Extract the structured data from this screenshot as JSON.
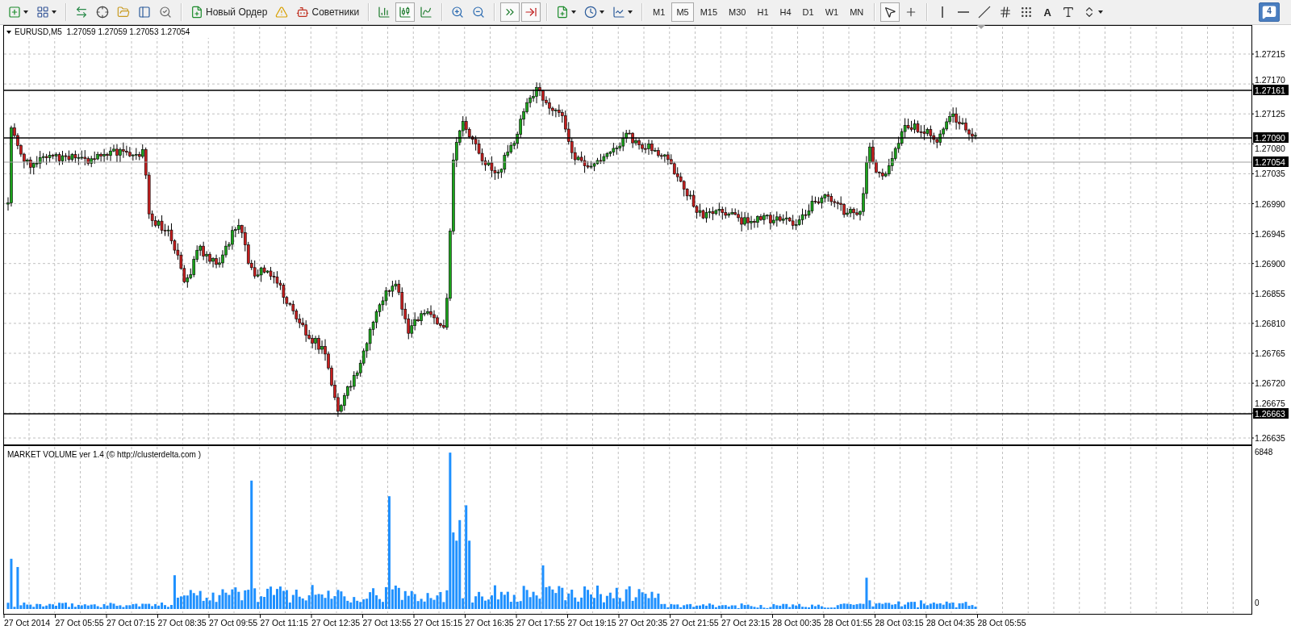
{
  "toolbar": {
    "buttons": [
      {
        "kind": "new-order",
        "label": "Новый Ордер"
      },
      {
        "kind": "experts",
        "label": "Советники"
      }
    ],
    "timeframes": [
      {
        "label": "M1",
        "selected": false
      },
      {
        "label": "M5",
        "selected": true
      },
      {
        "label": "M15",
        "selected": false
      },
      {
        "label": "M30",
        "selected": false
      },
      {
        "label": "H1",
        "selected": false
      },
      {
        "label": "H4",
        "selected": false
      },
      {
        "label": "D1",
        "selected": false
      },
      {
        "label": "W1",
        "selected": false
      },
      {
        "label": "MN",
        "selected": false
      }
    ],
    "text_tool": "A",
    "notification_count": "4"
  },
  "chart": {
    "title": "EURUSD,M5  1.27059 1.27059 1.27053 1.27054",
    "price_labels": [
      "1.27215",
      "1.27170",
      "1.27125",
      "1.27080",
      "1.27035",
      "1.26990",
      "1.26945",
      "1.26900",
      "1.26855",
      "1.26810",
      "1.26765",
      "1.26720",
      "1.26675",
      "1.26635"
    ],
    "levels": [
      {
        "kind": "line",
        "label": "1.27161"
      },
      {
        "kind": "line",
        "label": "1.27090"
      },
      {
        "kind": "current",
        "label": "1.27054"
      },
      {
        "kind": "line",
        "label": "1.26663"
      }
    ]
  },
  "volume": {
    "title": "MARKET VOLUME ver 1.4 (© http://clusterdelta.com )",
    "scale_max": "6848",
    "scale_min": "0"
  },
  "time_labels": [
    "27 Oct 2014",
    "27 Oct 05:55",
    "27 Oct 07:15",
    "27 Oct 08:35",
    "27 Oct 09:55",
    "27 Oct 11:15",
    "27 Oct 12:35",
    "27 Oct 13:55",
    "27 Oct 15:15",
    "27 Oct 16:35",
    "27 Oct 17:55",
    "27 Oct 19:15",
    "27 Oct 20:35",
    "27 Oct 21:55",
    "27 Oct 23:15",
    "28 Oct 00:35",
    "28 Oct 01:55",
    "28 Oct 03:15",
    "28 Oct 04:35",
    "28 Oct 05:55"
  ]
}
